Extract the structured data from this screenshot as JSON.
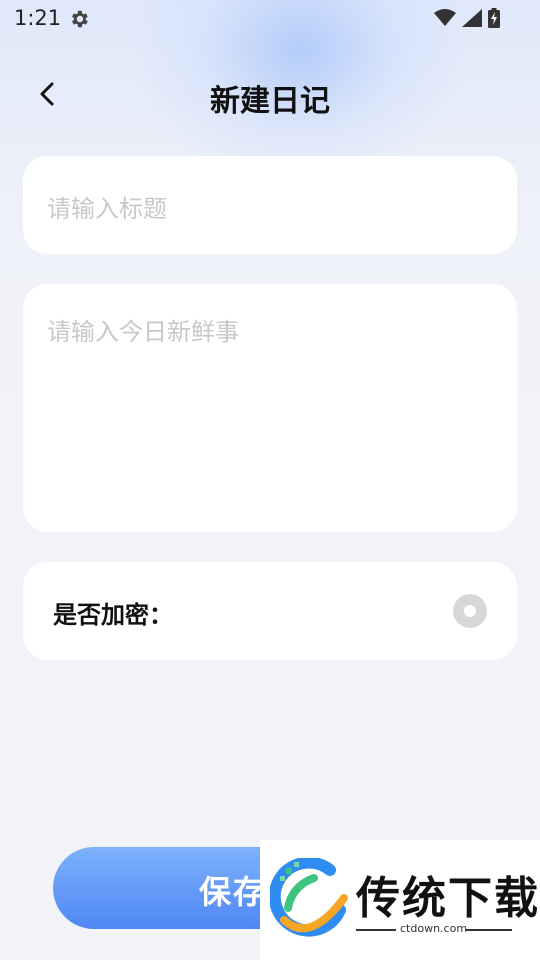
{
  "status_bar": {
    "time": "1:21"
  },
  "header": {
    "title": "新建日记"
  },
  "form": {
    "title_placeholder": "请输入标题",
    "content_placeholder": "请输入今日新鲜事",
    "encrypt_label": "是否加密："
  },
  "footer": {
    "save_label": "保存"
  },
  "watermark": {
    "name": "传统下载",
    "url": "ctdown.com"
  },
  "colors": {
    "accent": "#4f87f4",
    "page_bg": "#f2f3f8",
    "placeholder": "#c8c8cc"
  },
  "icons": [
    "gear-icon",
    "wifi-icon",
    "signal-icon",
    "battery-icon",
    "back-arrow-icon"
  ]
}
